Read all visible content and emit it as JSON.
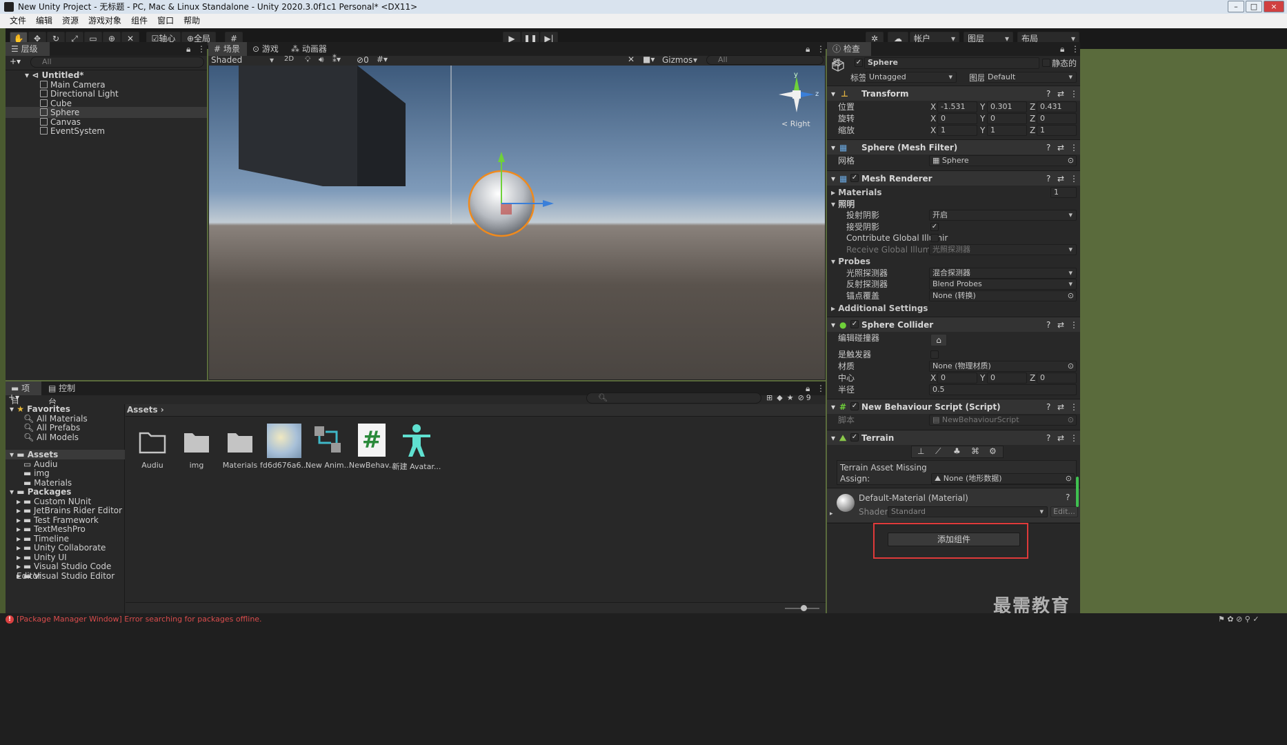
{
  "window": {
    "title": "New Unity Project - 无标题 - PC, Mac & Linux Standalone - Unity 2020.3.0f1c1 Personal* <DX11>"
  },
  "menu": [
    "文件",
    "编辑",
    "资源",
    "游戏对象",
    "组件",
    "窗口",
    "帮助"
  ],
  "toolbar": {
    "pivot": "轴心",
    "global": "全局",
    "account": "帐户",
    "layers": "图层",
    "layout": "布局"
  },
  "hierarchy": {
    "tab": "层级",
    "search_placeholder": "All",
    "scene": "Untitled*",
    "items": [
      "Main Camera",
      "Directional Light",
      "Cube",
      "Sphere",
      "Canvas",
      "EventSystem"
    ]
  },
  "scene": {
    "tabs": [
      "场景",
      "游戏",
      "动画器"
    ],
    "shading": "Shaded",
    "mode2d": "2D",
    "hidden_count": "0",
    "gizmos": "Gizmos",
    "search_placeholder": "All",
    "gizmo_label": "Right",
    "axis_y": "y",
    "axis_z": "z"
  },
  "project": {
    "tabs": [
      "项目",
      "控制台"
    ],
    "favorites_label": "Favorites",
    "favorites": [
      "All Materials",
      "All Prefabs",
      "All Models"
    ],
    "assets_label": "Assets",
    "asset_folders": [
      "Audiu",
      "img",
      "Materials"
    ],
    "packages_label": "Packages",
    "packages": [
      "Custom NUnit",
      "JetBrains Rider Editor",
      "Test Framework",
      "TextMeshPro",
      "Timeline",
      "Unity Collaborate",
      "Unity UI",
      "Visual Studio Code Editor",
      "Visual Studio Editor"
    ],
    "breadcrumb": "Assets",
    "hidden_count": "9",
    "assets": [
      "Audiu",
      "img",
      "Materials",
      "fd6d676a6...",
      "New Anim...",
      "NewBehav...",
      "新建 Avatar..."
    ]
  },
  "inspector": {
    "tab": "检查器",
    "object_name": "Sphere",
    "static_label": "静态的",
    "tag_label": "标签",
    "tag_value": "Untagged",
    "layer_label": "图层",
    "layer_value": "Default",
    "transform": {
      "title": "Transform",
      "position_label": "位置",
      "rotation_label": "旋转",
      "scale_label": "缩放",
      "position": [
        "-1.531",
        "0.301",
        "0.431"
      ],
      "rotation": [
        "0",
        "0",
        "0"
      ],
      "scale": [
        "1",
        "1",
        "1"
      ]
    },
    "axis": [
      "X",
      "Y",
      "Z"
    ],
    "mesh_filter": {
      "title": "Sphere (Mesh Filter)",
      "mesh_label": "网格",
      "mesh_value": "Sphere"
    },
    "mesh_renderer": {
      "title": "Mesh Renderer",
      "materials_label": "Materials",
      "materials_count": "1",
      "lighting_label": "照明",
      "cast_shadows_label": "投射阴影",
      "cast_shadows_value": "开启",
      "receive_shadows_label": "接受阴影",
      "contribute_gi_label": "Contribute Global Illumir",
      "receive_gi_label": "Receive Global Illuminati",
      "receive_gi_value": "光照探测器",
      "probes_label": "Probes",
      "light_probes_label": "光照探测器",
      "light_probes_value": "混合探测器",
      "reflection_probes_label": "反射探测器",
      "reflection_probes_value": "Blend Probes",
      "anchor_label": "锚点覆盖",
      "anchor_value": "None (转换)",
      "additional_label": "Additional Settings"
    },
    "sphere_collider": {
      "title": "Sphere Collider",
      "edit_label": "编辑碰撞器",
      "trigger_label": "是触发器",
      "material_label": "材质",
      "material_value": "None (物理材质)",
      "center_label": "中心",
      "center": [
        "0",
        "0",
        "0"
      ],
      "radius_label": "半径",
      "radius": "0.5"
    },
    "script": {
      "title": "New Behaviour Script (Script)",
      "script_label": "脚本",
      "script_value": "NewBehaviourScript"
    },
    "terrain": {
      "title": "Terrain",
      "missing": "Terrain Asset Missing",
      "assign_label": "Assign:",
      "assign_value": "None (地形数据)"
    },
    "material": {
      "title": "Default-Material (Material)",
      "shader_label": "Shader",
      "shader_value": "Standard",
      "edit_label": "Edit..."
    },
    "add_component": "添加组件"
  },
  "status": {
    "error": "[Package Manager Window] Error searching for packages offline."
  },
  "watermark": "最需教育",
  "colors": {
    "accent_highlight": "#e03a3a",
    "error_text": "#d94c4c",
    "selection_outline": "#f08a1c",
    "sky_top": "#3c5a7a",
    "ground": "#514a43"
  }
}
